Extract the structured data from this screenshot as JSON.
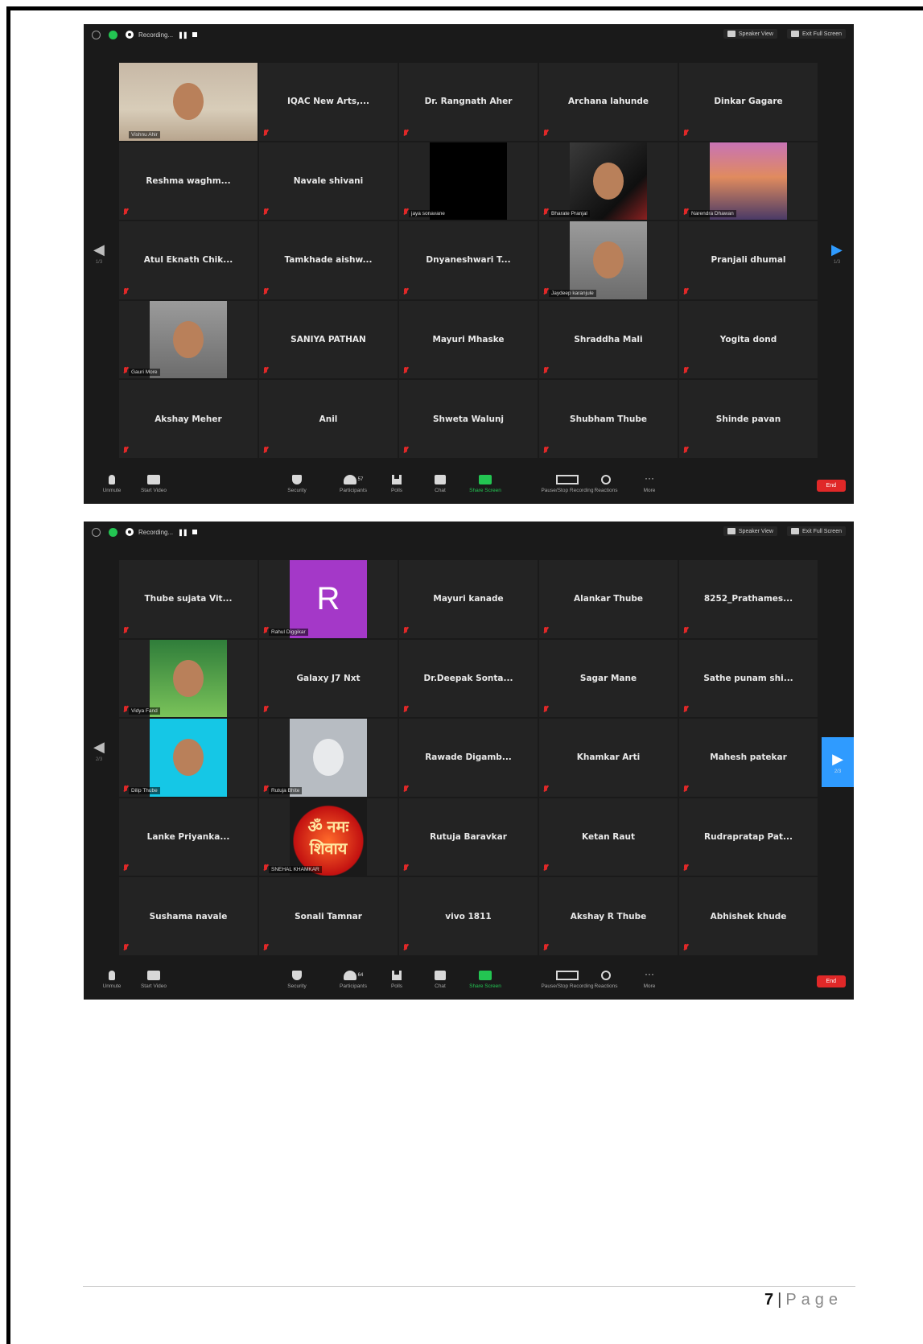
{
  "window1": {
    "recording_label": "Recording...",
    "speaker_view": "Speaker View",
    "exit_full_screen": "Exit Full Screen",
    "tiles": [
      {
        "name": "",
        "label": "Vishnu Ahir",
        "video": "room",
        "active": true
      },
      {
        "name": "IQAC New Arts,...",
        "label": ""
      },
      {
        "name": "Dr. Rangnath Aher",
        "label": ""
      },
      {
        "name": "Archana lahunde",
        "label": ""
      },
      {
        "name": "Dinkar Gagare",
        "label": ""
      },
      {
        "name": "Reshma waghm...",
        "label": ""
      },
      {
        "name": "Navale shivani",
        "label": ""
      },
      {
        "name": "",
        "label": "jaya sonavane",
        "video": "black"
      },
      {
        "name": "",
        "label": "Bharate Pranjal",
        "video": "dark"
      },
      {
        "name": "",
        "label": "Narendra Dhawan",
        "video": "temple"
      },
      {
        "name": "Atul Eknath Chik...",
        "label": ""
      },
      {
        "name": "Tamkhade aishw...",
        "label": ""
      },
      {
        "name": "Dnyaneshwari T...",
        "label": ""
      },
      {
        "name": "",
        "label": "Jaydeep karanjule",
        "video": "selfie"
      },
      {
        "name": "Pranjali dhumal",
        "label": ""
      },
      {
        "name": "",
        "label": "Gauri More",
        "video": "selfie"
      },
      {
        "name": "SANIYA PATHAN",
        "label": ""
      },
      {
        "name": "Mayuri Mhaske",
        "label": ""
      },
      {
        "name": "Shraddha Mali",
        "label": ""
      },
      {
        "name": "Yogita dond",
        "label": ""
      },
      {
        "name": "Akshay Meher",
        "label": ""
      },
      {
        "name": "Anil",
        "label": ""
      },
      {
        "name": "Shweta Walunj",
        "label": ""
      },
      {
        "name": "Shubham Thube",
        "label": ""
      },
      {
        "name": "Shinde pavan",
        "label": ""
      }
    ],
    "left_page": "1/3",
    "right_page": "1/3",
    "participants_count": "57"
  },
  "window2": {
    "recording_label": "Recording...",
    "speaker_view": "Speaker View",
    "exit_full_screen": "Exit Full Screen",
    "tiles": [
      {
        "name": "Thube sujata Vit...",
        "label": ""
      },
      {
        "name": "",
        "label": "Rahul Diggikar",
        "video": "purple",
        "letter": "R"
      },
      {
        "name": "Mayuri kanade",
        "label": ""
      },
      {
        "name": "Alankar Thube",
        "label": ""
      },
      {
        "name": "8252_Prathames...",
        "label": ""
      },
      {
        "name": "",
        "label": "Vidya Fand",
        "video": "green"
      },
      {
        "name": "Galaxy J7 Nxt",
        "label": ""
      },
      {
        "name": "Dr.Deepak Sonta...",
        "label": ""
      },
      {
        "name": "Sagar Mane",
        "label": ""
      },
      {
        "name": "Sathe punam shi...",
        "label": ""
      },
      {
        "name": "",
        "label": "Dilip Thube",
        "video": "sky"
      },
      {
        "name": "",
        "label": "Rutuja Bhite",
        "video": "grey"
      },
      {
        "name": "Rawade Digamb...",
        "label": ""
      },
      {
        "name": "Khamkar Arti",
        "label": ""
      },
      {
        "name": "Mahesh patekar",
        "label": ""
      },
      {
        "name": "Lanke Priyanka...",
        "label": ""
      },
      {
        "name": "",
        "label": "SNEHAL KHAMKAR",
        "video": "orange",
        "letter": "ॐ नमः शिवाय"
      },
      {
        "name": "Rutuja Baravkar",
        "label": ""
      },
      {
        "name": "Ketan Raut",
        "label": ""
      },
      {
        "name": "Rudrapratap Pat...",
        "label": ""
      },
      {
        "name": "Sushama navale",
        "label": ""
      },
      {
        "name": "Sonali Tamnar",
        "label": ""
      },
      {
        "name": "vivo 1811",
        "label": ""
      },
      {
        "name": "Akshay R Thube",
        "label": ""
      },
      {
        "name": "Abhishek khude",
        "label": ""
      }
    ],
    "left_page": "2/3",
    "right_page": "2/3",
    "participants_count": "64"
  },
  "toolbar": {
    "unmute": "Unmute",
    "start_video": "Start Video",
    "security": "Security",
    "participants": "Participants",
    "polls": "Polls",
    "chat": "Chat",
    "share_screen": "Share Screen",
    "pause_recording": "Pause/Stop Recording",
    "reactions": "Reactions",
    "more": "More",
    "end": "End"
  },
  "footer": {
    "page_number": "7",
    "separator": "|",
    "page_word": "Page"
  }
}
